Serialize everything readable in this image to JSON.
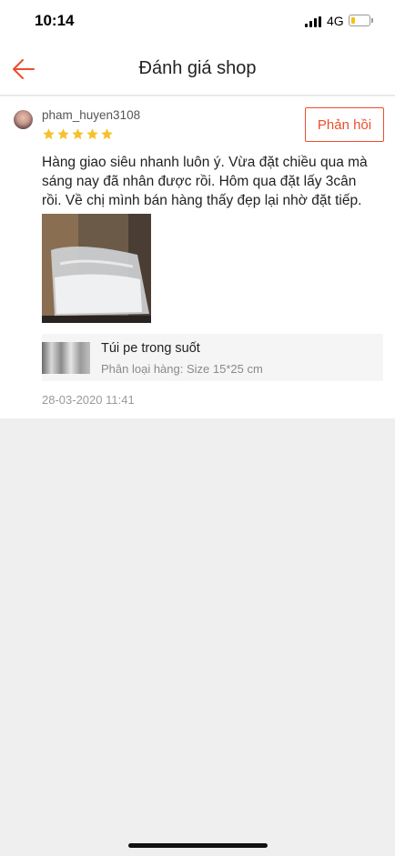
{
  "status_bar": {
    "time": "10:14",
    "network": "4G",
    "battery_level": 0.25,
    "battery_color": "#f2c40f"
  },
  "nav": {
    "back_icon": "arrow-left-icon",
    "title": "Đánh giá shop",
    "accent_color": "#ee4d2d"
  },
  "review": {
    "username": "pham_huyen3108",
    "rating": 5,
    "star_color": "#f6c12c",
    "reply_label": "Phản hồi",
    "text": "Hàng giao siêu nhanh luôn ý. Vừa đặt chiều qua mà sáng nay đã nhân được rồi. Hôm qua đặt lấy 3cân rồi. Về chị mình bán hàng thấy đẹp lại nhờ đặt tiếp.",
    "product": {
      "name": "Túi pe trong suốt",
      "variant": "Phân loại hàng: Size 15*25 cm"
    },
    "date": "28-03-2020 11:41"
  }
}
